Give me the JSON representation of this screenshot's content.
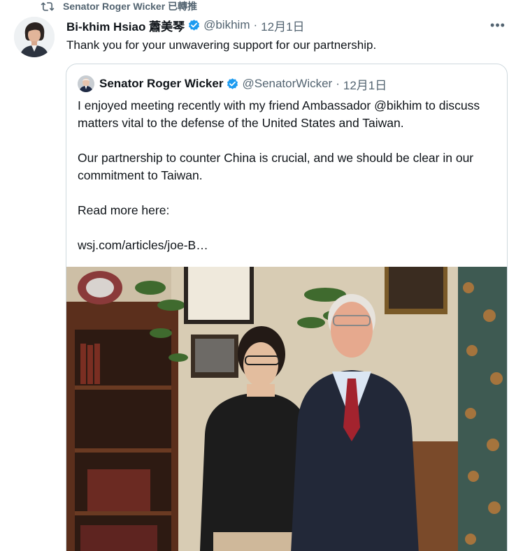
{
  "retweet": {
    "text": "Senator Roger Wicker 已轉推",
    "icon": "retweet-icon"
  },
  "tweet": {
    "author_name": "Bi-khim Hsiao 蕭美琴",
    "handle": "@bikhim",
    "separator": "·",
    "date": "12月1日",
    "more_label": "•••",
    "text": "Thank you for your unwavering support for our partnership.",
    "verified_icon": "verified-badge-icon"
  },
  "quote": {
    "author_name": "Senator Roger Wicker",
    "handle": "@SenatorWicker",
    "separator": "·",
    "date": "12月1日",
    "paragraphs": [
      "I enjoyed meeting recently with my friend Ambassador @bikhim to discuss matters vital to the defense of the United States and Taiwan.",
      "Our partnership to counter China is crucial, and we should be clear in our commitment to Taiwan.",
      "Read more here:"
    ],
    "link": "wsj.com/articles/joe-B…"
  },
  "colors": {
    "text": "#0f1419",
    "secondary": "#536471",
    "verified": "#1d9bf0",
    "border": "#cfd9de"
  }
}
